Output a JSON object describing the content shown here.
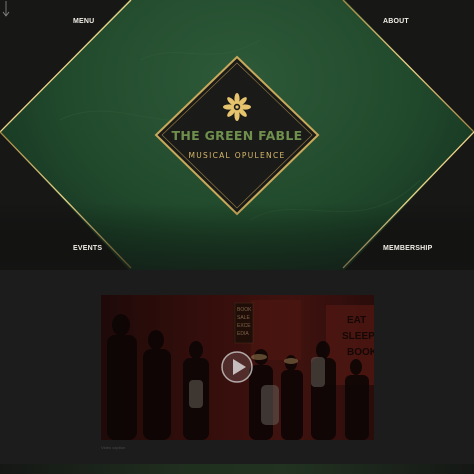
{
  "nav": {
    "menu": "MENU",
    "about": "ABOUT",
    "events": "EVENTS",
    "membership": "MEMBERSHIP"
  },
  "logo": {
    "title": "THE GREEN FABLE",
    "subtitle": "MUSICAL OPULENCE",
    "emblem_icon": "gold-flower-icon"
  },
  "video": {
    "play_icon": "play-icon",
    "sign_text": [
      "BOOK",
      "SALE",
      "EXCE",
      "EDIA"
    ],
    "wall_text": [
      "EAT",
      "SLEEP",
      "BOOK"
    ],
    "caption": "Video caption"
  },
  "colors": {
    "background": "#1c1c1c",
    "diamond_green": "#1f4a2a",
    "gold": "#d9b96a",
    "title_green": "#6f8f4c"
  }
}
